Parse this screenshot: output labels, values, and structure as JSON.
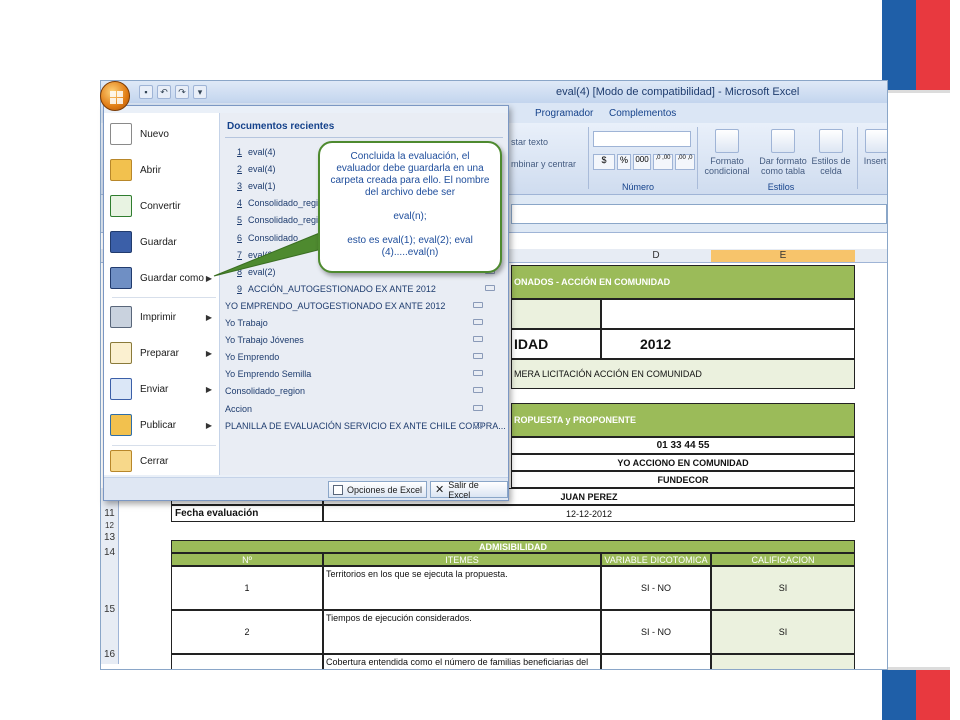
{
  "window": {
    "title": "eval(4)  [Modo de compatibilidad] - Microsoft Excel"
  },
  "tabs": [
    "Programador",
    "Complementos"
  ],
  "ribbon": {
    "alignment_partial": [
      "star texto",
      "mbinar y centrar"
    ],
    "numero_group": "Número",
    "percent_symbol": "%",
    "thousands": "000",
    "currency_symbol": "$",
    "dec_inc": ",0 ,00",
    "dec_dec": ",00 ,0",
    "formato_condicional": "Formato condicional",
    "dar_formato": "Dar formato como tabla",
    "estilos_celda": "Estilos de celda",
    "estilos_group": "Estilos",
    "insertar": "Insert"
  },
  "office_menu": {
    "left_items": [
      {
        "label": "Nuevo",
        "icon": "new-document-icon",
        "submenu": false
      },
      {
        "label": "Abrir",
        "icon": "open-folder-icon",
        "submenu": false
      },
      {
        "label": "Convertir",
        "icon": "convert-icon",
        "submenu": false
      },
      {
        "label": "Guardar",
        "icon": "save-disk-icon",
        "submenu": false
      },
      {
        "label": "Guardar como",
        "icon": "save-as-icon",
        "submenu": true
      },
      {
        "label": "Imprimir",
        "icon": "printer-icon",
        "submenu": true
      },
      {
        "label": "Preparar",
        "icon": "prepare-pen-icon",
        "submenu": true
      },
      {
        "label": "Enviar",
        "icon": "send-icon",
        "submenu": true
      },
      {
        "label": "Publicar",
        "icon": "publish-folder-icon",
        "submenu": true
      },
      {
        "label": "Cerrar",
        "icon": "close-folder-icon",
        "submenu": false
      }
    ],
    "recent_title": "Documentos recientes",
    "recent": [
      {
        "num": "1",
        "name": "eval(4)"
      },
      {
        "num": "2",
        "name": "eval(4)"
      },
      {
        "num": "3",
        "name": "eval(1)"
      },
      {
        "num": "4",
        "name": "Consolidado_region"
      },
      {
        "num": "5",
        "name": "Consolidado_region"
      },
      {
        "num": "6",
        "name": "Consolidado_"
      },
      {
        "num": "7",
        "name": "eval(3)"
      },
      {
        "num": "8",
        "name": "eval(2)"
      },
      {
        "num": "9",
        "name": "ACCIÓN_AUTOGESTIONADO EX ANTE  2012"
      },
      {
        "num": "",
        "name": "YO EMPRENDO_AUTOGESTIONADO EX ANTE  2012"
      },
      {
        "num": "",
        "name": "Yo Trabajo"
      },
      {
        "num": "",
        "name": "Yo Trabajo Jóvenes"
      },
      {
        "num": "",
        "name": "Yo Emprendo"
      },
      {
        "num": "",
        "name": "Yo Emprendo Semilla"
      },
      {
        "num": "",
        "name": "Consolidado_region"
      },
      {
        "num": "",
        "name": "Accion"
      },
      {
        "num": "",
        "name": "PLANILLA DE EVALUACIÓN  SERVICIO EX ANTE CHILE COMPRA..."
      }
    ],
    "opciones_button": "Opciones de Excel",
    "salir_button": "Salir de Excel"
  },
  "callout": {
    "text": "Concluida la evaluación, el evaluador debe guardarla en una carpeta creada para ello. El nombre del archivo debe ser\n\neval(n);\n\nesto es eval(1); eval(2); eval (4).....eval(n)"
  },
  "sheet": {
    "columns": [
      "D",
      "E"
    ],
    "banner_1": "ONADOS - ACCIÓN EN COMUNIDAD",
    "banner_2_a": "IDAD",
    "banner_2_b": "2012",
    "banner_3": "MERA LICITACIÓN ACCIÓN EN COMUNIDAD",
    "section_proponente": "ROPUESTA y PROPONENTE",
    "values": [
      "01 33 44 55",
      "YO ACCIONO EN COMUNIDAD",
      "FUNDECOR"
    ],
    "rows": [
      {
        "num": "10",
        "label": "Nombre evaluador",
        "value": "JUAN PEREZ"
      },
      {
        "num": "11",
        "label": "Fecha evaluación",
        "value": "12-12-2012"
      }
    ],
    "row_12": "12",
    "row_13": "13",
    "row_14": "14",
    "row_15": "15",
    "row_16": "16",
    "admisibilidad": "ADMISIBILIDAD",
    "headers": [
      "Nº",
      "ITEMES",
      "VARIABLE DICOTOMICA",
      "CALIFICACION"
    ],
    "items": [
      {
        "n": "1",
        "text": "Territorios en los que se ejecuta la propuesta.",
        "var": "SI - NO",
        "cal": "SI"
      },
      {
        "n": "2",
        "text": "Tiempos de ejecución considerados.",
        "var": "SI - NO",
        "cal": "SI"
      },
      {
        "n": "",
        "text": "Cobertura entendida como el número de familias beneficiarias del",
        "var": "",
        "cal": ""
      }
    ]
  }
}
